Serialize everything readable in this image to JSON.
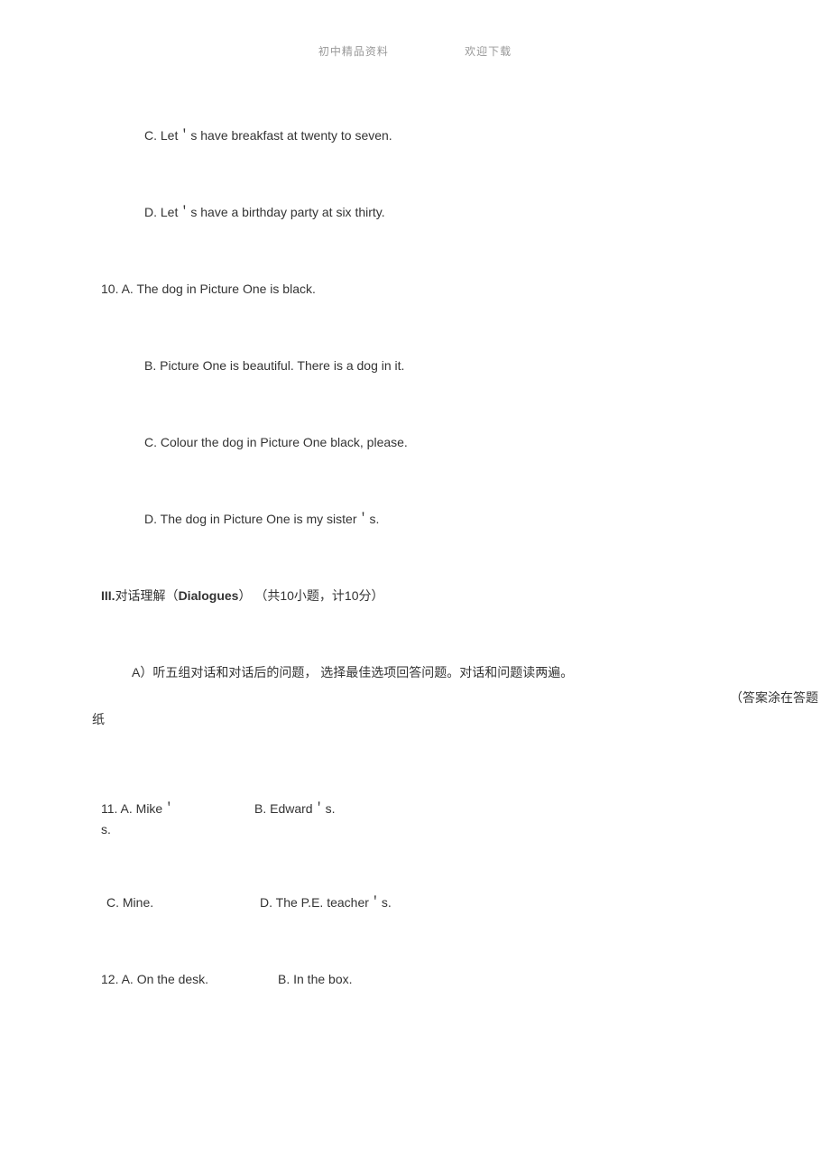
{
  "header": {
    "left": "初中精品资料",
    "right": "欢迎下载"
  },
  "body": {
    "opt_c1": "C.  Let＇s have breakfast at twenty to seven.",
    "opt_d1": "D.  Let＇s have a birthday party at six thirty.",
    "q10_a": "10.  A. The dog in Picture One is black.",
    "opt_b2": "B.  Picture One is beautiful. There is a dog in it.",
    "opt_c2": "C.  Colour the dog in Picture One black, please.",
    "opt_d2": "D.  The dog in Picture One is my sister＇s.",
    "section3_prefix": "III.",
    "section3_mid1": "对话理解（",
    "section3_bold": "Dialogues",
    "section3_mid2": "） （共10小题，计10分）",
    "instruction_a": "A）听五组对话和对话后的问题， 选择最佳选项回答问题。对话和问题读两遍。",
    "note_right": "（答案涂在答题",
    "note_left": "纸",
    "q11_a": "11.  A. Mike＇",
    "q11_s": "s.",
    "q11_b": "B.  Edward＇s.",
    "q11_c": " C. Mine.",
    "q11_d": "D. The P.E. teacher＇s.",
    "q12_a": "12. A. On the desk.",
    "q12_b": "B. In the box."
  }
}
